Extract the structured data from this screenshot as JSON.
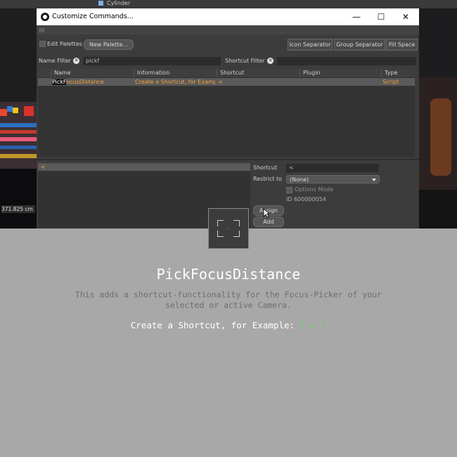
{
  "scene": {
    "object_label": "Cylinder",
    "measurement": "371.825 cm"
  },
  "dialog": {
    "title": "Customize Commands...",
    "window_buttons": {
      "minimize": "—",
      "maximize": "☐",
      "close": "✕"
    },
    "toolbar": {
      "edit_palettes_label": "Edit Palettes",
      "new_palette_label": "New Palette...",
      "icon_separator_label": "Icon Separator",
      "group_separator_label": "Group Separator",
      "fill_space_label": "Fill Space"
    },
    "filters": {
      "name_filter_label": "Name Filter",
      "name_filter_value": "pickf",
      "shortcut_filter_label": "Shortcut Filter",
      "shortcut_filter_value": "",
      "clear_glyph": "✕"
    },
    "table": {
      "columns": [
        "Name",
        "Information",
        "Shortcut",
        "Plugin",
        "Type"
      ],
      "rows": [
        {
          "name_match": "PickF",
          "name_rest": "ocusDistance",
          "information": "Create a Shortcut, for Exampl",
          "shortcut": "<",
          "plugin": "",
          "type": "Script"
        }
      ]
    },
    "lower": {
      "shortcut_list_item": "<",
      "shortcut_label": "Shortcut",
      "shortcut_value": "<",
      "restrict_to_label": "Restrict to",
      "restrict_to_value": "(None)",
      "options_mode_label": "Options Mode",
      "id_text": "ID 600000054",
      "assign_label": "Assign",
      "add_label": "Add"
    }
  },
  "overlay": {
    "title": "PickFocusDistance",
    "description": "This adds a shortcut-functionality for the Focus-Picker of your selected or active Camera.",
    "example_prefix": "Create a Shortcut, for Example:",
    "example_key": "[ < ]"
  },
  "colors": {
    "accent_orange": "#f4a13a",
    "example_green": "#5bd65b"
  }
}
